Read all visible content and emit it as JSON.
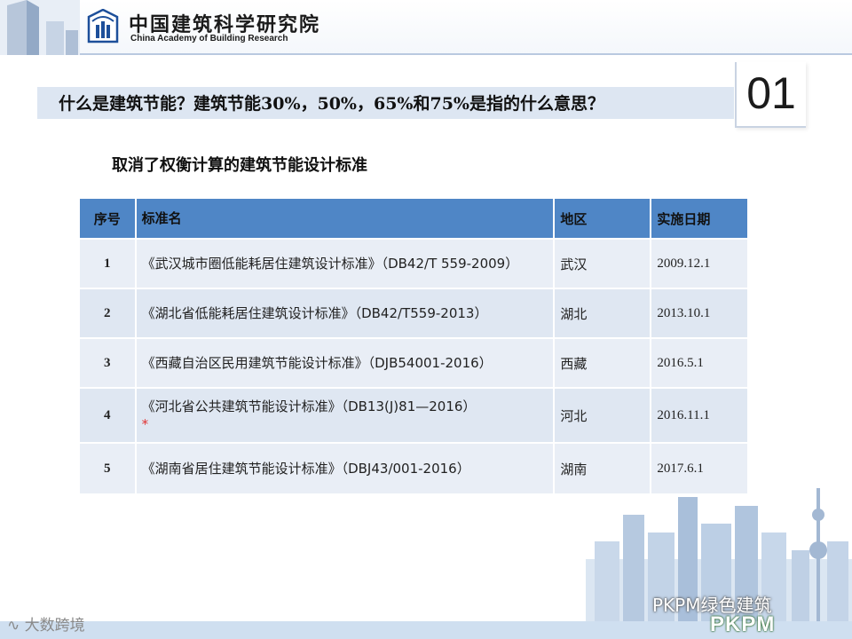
{
  "header": {
    "org_name_cn": "中国建筑科学研究院",
    "org_name_en": "China Academy of Building Research"
  },
  "question": "什么是建筑节能？建筑节能30%，50%，65%和75%是指的什么意思？",
  "section_number": "01",
  "subtitle": "取消了权衡计算的建筑节能设计标准",
  "table": {
    "headers": [
      "序号",
      "标准名",
      "地区",
      "实施日期"
    ],
    "rows": [
      {
        "idx": "1",
        "name": "《武汉城市圈低能耗居住建筑设计标准》（DB42/T 559-2009）",
        "region": "武汉",
        "date": "2009.12.1",
        "mark": ""
      },
      {
        "idx": "2",
        "name": "《湖北省低能耗居住建筑设计标准》（DB42/T559-2013）",
        "region": "湖北",
        "date": "2013.10.1",
        "mark": ""
      },
      {
        "idx": "3",
        "name": "《西藏自治区民用建筑节能设计标准》（DJB54001-2016）",
        "region": "西藏",
        "date": "2016.5.1",
        "mark": ""
      },
      {
        "idx": "4",
        "name": "《河北省公共建筑节能设计标准》（DB13(J)81—2016）",
        "region": "河北",
        "date": "2016.11.1",
        "mark": "*"
      },
      {
        "idx": "5",
        "name": "《湖南省居住建筑节能设计标准》（DBJ43/001-2016）",
        "region": "湖南",
        "date": "2017.6.1",
        "mark": ""
      }
    ]
  },
  "watermarks": {
    "left": "大数跨境",
    "wechat": "PKPM绿色建筑",
    "brand": "PKPM"
  }
}
